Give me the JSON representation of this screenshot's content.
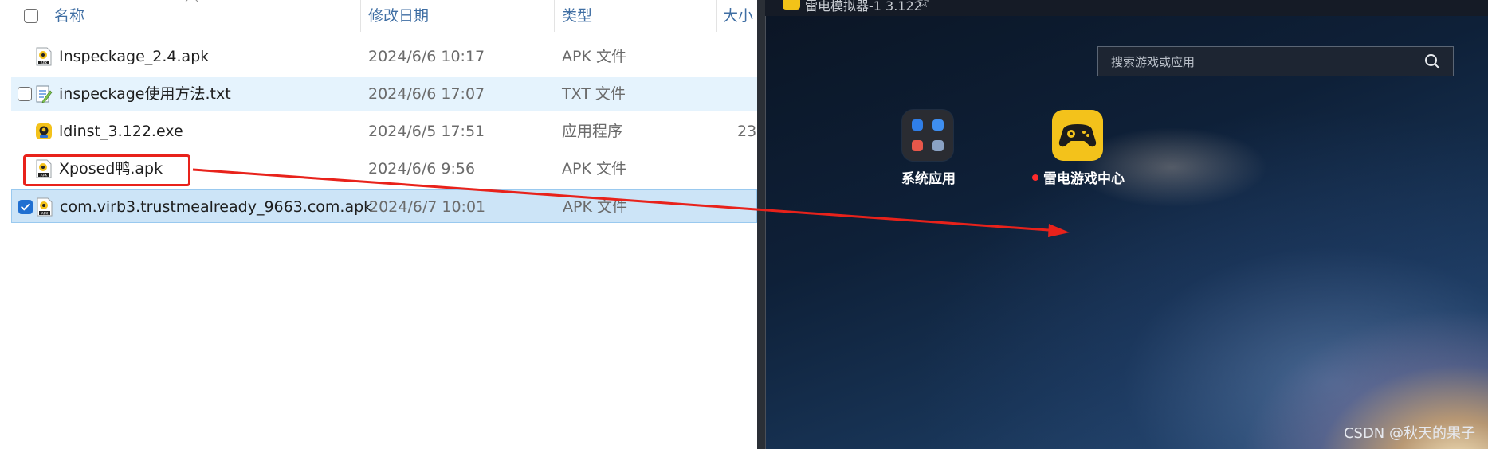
{
  "explorer": {
    "columns": {
      "name": "名称",
      "date": "修改日期",
      "type": "类型",
      "size": "大小"
    },
    "files": [
      {
        "name": "Inspeckage_2.4.apk",
        "date": "2024/6/6 10:17",
        "type": "APK 文件",
        "size": "",
        "icon": "apk-file-icon",
        "checked": false,
        "state": "normal"
      },
      {
        "name": "inspeckage使用方法.txt",
        "date": "2024/6/6 17:07",
        "type": "TXT 文件",
        "size": "",
        "icon": "txt-file-icon",
        "checked": false,
        "state": "hover"
      },
      {
        "name": "ldinst_3.122.exe",
        "date": "2024/6/5 17:51",
        "type": "应用程序",
        "size": "23",
        "icon": "exe-installer-icon",
        "checked": false,
        "state": "normal"
      },
      {
        "name": "Xposed鸭.apk",
        "date": "2024/6/6 9:56",
        "type": "APK 文件",
        "size": "",
        "icon": "apk-file-icon",
        "checked": false,
        "state": "highlighted"
      },
      {
        "name": "com.virb3.trustmealready_9663.com.apk",
        "date": "2024/6/7 10:01",
        "type": "APK 文件",
        "size": "",
        "icon": "apk-file-icon",
        "checked": true,
        "state": "selected"
      }
    ]
  },
  "emulator": {
    "title": "雷电模拟器-1 3.122",
    "search_placeholder": "搜索游戏或应用",
    "apps": [
      {
        "label": "系统应用",
        "icon": "system-apps-folder-icon",
        "badge": false
      },
      {
        "label": "雷电游戏中心",
        "icon": "gamepad-icon",
        "badge": true
      }
    ],
    "watermark": "CSDN @秋天的果子"
  },
  "colors": {
    "accent": "#1f6fd1",
    "annotation": "#e8221b",
    "brand_yellow": "#f3c21b"
  }
}
